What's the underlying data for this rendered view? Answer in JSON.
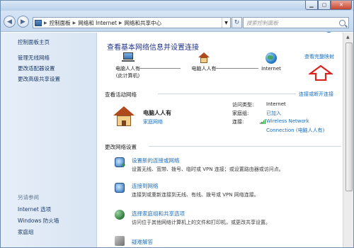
{
  "address": {
    "crumbs": [
      "控制面板",
      "网络和 Internet",
      "网络和共享中心"
    ],
    "search_placeholder": "搜索控制面板"
  },
  "sidebar": {
    "home": "控制面板主页",
    "links": [
      "管理无线网络",
      "更改适配器设置",
      "更改高级共享设置"
    ],
    "see_also_heading": "另请参阅",
    "see_also": [
      "Internet 选项",
      "Windows 防火墙",
      "家庭组"
    ]
  },
  "main": {
    "title": "查看基本网络信息并设置连接",
    "view_full_map": "查看完整映射",
    "map_nodes": [
      {
        "line1": "电脑人人有",
        "line2": "(此计算机)"
      },
      {
        "line1": "电脑人人有",
        "line2": ""
      },
      {
        "line1": "Internet",
        "line2": ""
      }
    ],
    "active_networks_label": "查看活动网络",
    "connect_or_disconnect": "连接或断开连接",
    "network": {
      "name": "电脑人人有",
      "type": "家庭网络",
      "access_type_key": "访问类型:",
      "access_type_val": "Internet",
      "homegroup_key": "家庭组:",
      "homegroup_val": "已加入",
      "connections_key": "连接:",
      "connection_val_line1": "Wireless Network",
      "connection_val_line2": "Connection (电脑人人有)"
    },
    "change_settings_label": "更改网络设置",
    "tasks": [
      {
        "title": "设置新的连接或网络",
        "desc": "设置无线、宽带、拨号、临时或 VPN 连接；或设置路由器或访问点。"
      },
      {
        "title": "连接到网络",
        "desc": "连接到或重新连接到无线、有线、拨号或 VPN 网络连接。"
      },
      {
        "title": "选择家庭组和共享选项",
        "desc": "访问位于其他网络计算机上的文件和打印机，或更改共享设置。"
      },
      {
        "title": "疑难解答",
        "desc": ""
      }
    ]
  },
  "colors": {
    "link": "#1a6fbd",
    "title": "#1e3287",
    "annotation_arrow": "#d9231f"
  }
}
